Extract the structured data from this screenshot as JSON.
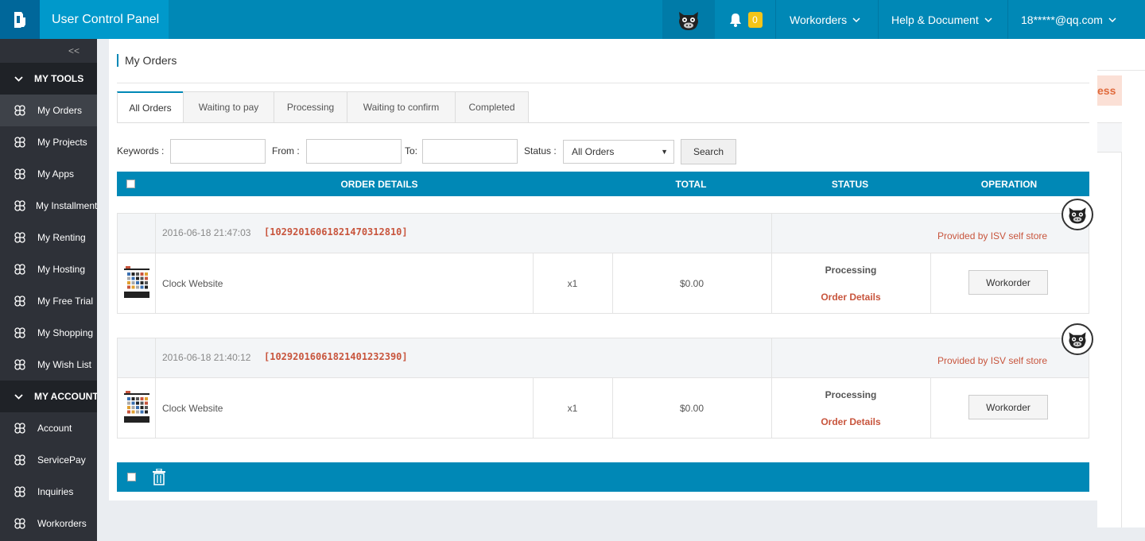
{
  "header": {
    "app_title": "User Control Panel",
    "notification_count": "0",
    "menus": {
      "workorders": "Workorders",
      "help": "Help & Document",
      "user": "18*****@qq.com"
    }
  },
  "sidebar": {
    "collapse_label": "<<",
    "sections": [
      {
        "title": "MY TOOLS",
        "items": [
          "My Orders",
          "My Projects",
          "My Apps",
          "My Installment",
          "My Renting",
          "My Hosting",
          "My Free Trial",
          "My Shopping",
          "My Wish List"
        ]
      },
      {
        "title": "MY ACCOUNT",
        "items": [
          "Account",
          "ServicePay",
          "Inquiries",
          "Workorders"
        ]
      }
    ],
    "active_item": "My Orders"
  },
  "ghost_text": "ess",
  "page": {
    "title": "My Orders",
    "tabs": [
      "All Orders",
      "Waiting to pay",
      "Processing",
      "Waiting to confirm",
      "Completed"
    ],
    "filters": {
      "keywords_label": "Keywords :",
      "from_label": "From :",
      "to_label": "To:",
      "status_label": "Status :",
      "status_value": "All Orders",
      "search_label": "Search"
    },
    "table": {
      "columns": [
        "ORDER DETAILS",
        "TOTAL",
        "STATUS",
        "OPERATION"
      ]
    },
    "orders": [
      {
        "date": "2016-06-18 21:47:03",
        "order_no": "[1029201606182147031281​0]",
        "provider": "Provided by ISV self store",
        "product": "Clock Website",
        "qty": "x1",
        "price": "$0.00",
        "status": "Processing",
        "details_link": "Order Details",
        "action": "Workorder"
      },
      {
        "date": "2016-06-18 21:40:12",
        "order_no": "[10292016061821401232390]",
        "provider": "Provided by ISV self store",
        "product": "Clock Website",
        "qty": "x1",
        "price": "$0.00",
        "status": "Processing",
        "details_link": "Order Details",
        "action": "Workorder"
      }
    ]
  },
  "colors": {
    "accent": "#0088b6",
    "sidebar": "#2e3138",
    "link": "#c8553d"
  }
}
